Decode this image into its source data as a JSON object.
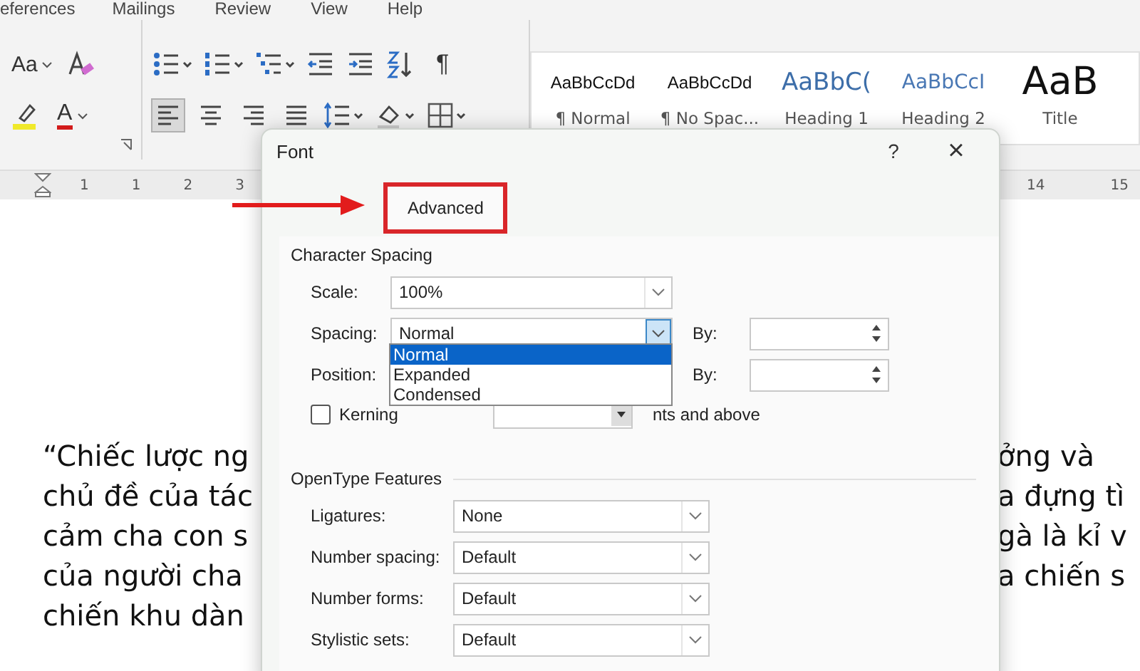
{
  "ribbon": {
    "menu_tabs": [
      "eferences",
      "Mailings",
      "Review",
      "View",
      "Help"
    ],
    "change_case_label": "Aa",
    "font_color_label": "A",
    "pilcrow": "¶",
    "align_buttons": [
      {
        "kind": "left",
        "selected": true
      },
      {
        "kind": "center",
        "selected": false
      },
      {
        "kind": "right",
        "selected": false
      },
      {
        "kind": "justify",
        "selected": false
      }
    ],
    "styles": [
      {
        "preview": "AaBbCcDd",
        "name": "¶ Normal",
        "kind": "body"
      },
      {
        "preview": "AaBbCcDd",
        "name": "¶ No Spac...",
        "kind": "body"
      },
      {
        "preview": "AaBbC(",
        "name": "Heading 1",
        "kind": "heading1"
      },
      {
        "preview": "AaBbCcI",
        "name": "Heading 2",
        "kind": "heading2"
      },
      {
        "preview": "AaB",
        "name": "Title",
        "kind": "title"
      }
    ]
  },
  "ruler": {
    "left_numbers": [
      "1",
      "1",
      "2",
      "3"
    ],
    "right_numbers": [
      "14",
      "15"
    ]
  },
  "document": {
    "left_lines": [
      "“Chiếc lược ng",
      "chủ đề của tác",
      "cảm cha con s",
      "của người cha",
      "chiến khu dàn"
    ],
    "right_lines": [
      "ởng và",
      "a đựng tì",
      "gà là kỉ v",
      "a chiến s"
    ]
  },
  "dialog": {
    "title": "Font",
    "help": "?",
    "close": "×",
    "tabs": [
      {
        "label": "Advanced",
        "selected": true,
        "highlighted": true
      }
    ],
    "character_spacing": {
      "title": "Character Spacing",
      "scale": {
        "label": "Scale:",
        "value": "100%"
      },
      "spacing": {
        "label": "Spacing:",
        "value": "Normal",
        "open": true,
        "options": [
          {
            "label": "Normal",
            "selected": true
          },
          {
            "label": "Expanded",
            "selected": false
          },
          {
            "label": "Condensed",
            "selected": false
          }
        ]
      },
      "spacing_by": {
        "label": "By:"
      },
      "position": {
        "label": "Position:"
      },
      "position_by": {
        "label": "By:"
      },
      "kerning": {
        "label": "Kerning",
        "checked": false,
        "suffix": "nts and above"
      }
    },
    "opentype": {
      "title": "OpenType Features",
      "rows": [
        {
          "label": "Ligatures:",
          "value": "None"
        },
        {
          "label": "Number spacing:",
          "value": "Default"
        },
        {
          "label": "Number forms:",
          "value": "Default"
        },
        {
          "label": "Stylistic sets:",
          "value": "Default"
        }
      ]
    }
  }
}
